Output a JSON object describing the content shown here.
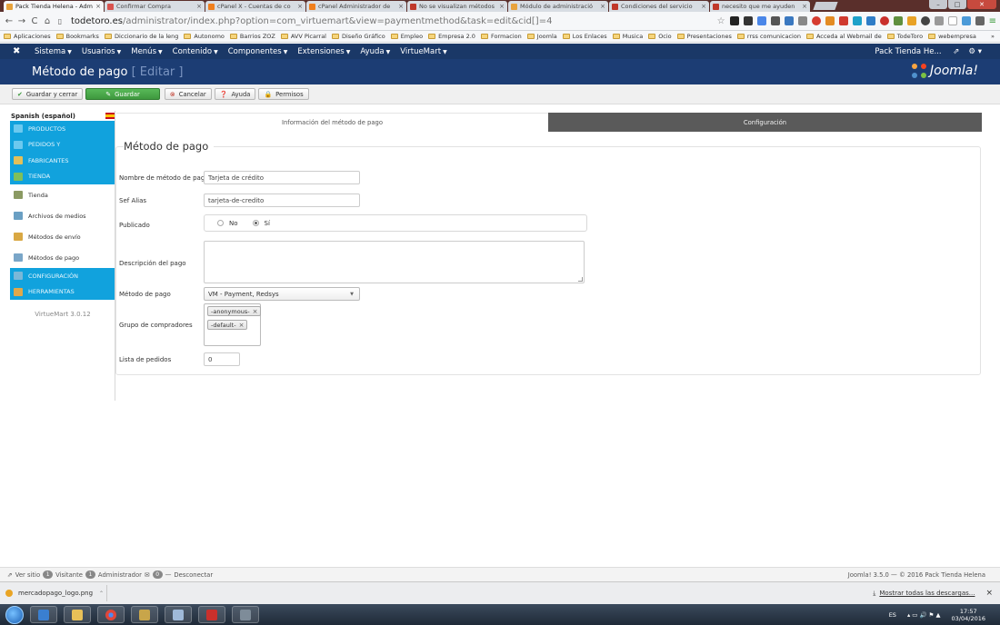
{
  "browser": {
    "tabs": [
      {
        "label": "Pack Tienda Helena - Adm",
        "color": "#e8a33c",
        "active": true
      },
      {
        "label": "Confirmar Compra",
        "color": "#d9534f",
        "active": false
      },
      {
        "label": "cPanel X - Cuentas de co",
        "color": "#f07f1d",
        "active": false
      },
      {
        "label": "cPanel Administrador de",
        "color": "#f07f1d",
        "active": false
      },
      {
        "label": "No se visualizan métodos",
        "color": "#c0392b",
        "active": false
      },
      {
        "label": "Módulo de administració",
        "color": "#e8a33c",
        "active": false
      },
      {
        "label": "Condiciones del servicio",
        "color": "#c0392b",
        "active": false
      },
      {
        "label": "necesito que me ayuden",
        "color": "#c0392b",
        "active": false
      }
    ],
    "url_host": "todetoro.es",
    "url_path": "/administrator/index.php?option=com_virtuemart&view=paymentmethod&task=edit&cid[]=4",
    "bookmarks": [
      "Aplicaciones",
      "Bookmarks",
      "Diccionario de la leng",
      "Autonomo",
      "Barrios ZOZ",
      "AVV Picarral",
      "Diseño Gráfico",
      "Empleo",
      "Empresa 2.0",
      "Formacion",
      "Joomla",
      "Los Enlaces",
      "Musica",
      "Ocio",
      "Presentaciones",
      "rrss comunicacion",
      "Acceda al Webmail de",
      "TodeToro",
      "webempresa"
    ],
    "more_bookmarks": "»"
  },
  "navbar": {
    "menus": [
      "Sistema",
      "Usuarios",
      "Menús",
      "Contenido",
      "Componentes",
      "Extensiones",
      "Ayuda",
      "VirtueMart"
    ],
    "site_name": "Pack Tienda He...",
    "brand": "Joomla!"
  },
  "header": {
    "title": "Método de pago",
    "subtitle": "[ Editar ]"
  },
  "toolbar": {
    "save_close": "Guardar y cerrar",
    "save": "Guardar",
    "cancel": "Cancelar",
    "help": "Ayuda",
    "permissions": "Permisos"
  },
  "sidebar": {
    "language": "Spanish (español)",
    "items": [
      {
        "label": "PRODUCTOS",
        "type": "blue",
        "icon": "#6cc9ef"
      },
      {
        "label": "PEDIDOS Y",
        "type": "blue",
        "icon": "#6cc9ef"
      },
      {
        "label": "FABRICANTES",
        "type": "blue",
        "icon": "#e2c05a"
      },
      {
        "label": "TIENDA",
        "type": "blue",
        "icon": "#7fbf5a"
      },
      {
        "label": "Tienda",
        "type": "white",
        "icon": "#8b9a63"
      },
      {
        "label": "Archivos de medios",
        "type": "white",
        "icon": "#6a9fc3"
      },
      {
        "label": "Métodos de envío",
        "type": "white",
        "icon": "#d9a843"
      },
      {
        "label": "Métodos de pago",
        "type": "white",
        "icon": "#7aa6c8"
      },
      {
        "label": "CONFIGURACIÓN",
        "type": "blue",
        "icon": "#7ab8d8"
      },
      {
        "label": "HERRAMIENTAS",
        "type": "blue",
        "icon": "#e0a84a"
      }
    ],
    "version": "VirtueMart 3.0.12"
  },
  "tabs": {
    "info": "Información del método de pago",
    "config": "Configuración"
  },
  "form": {
    "legend": "Método de pago",
    "name_label": "Nombre de método de pago",
    "name_value": "Tarjeta de crédito",
    "alias_label": "Sef Alias",
    "alias_value": "tarjeta-de-credito",
    "published_label": "Publicado",
    "published_no": "No",
    "published_yes": "Sí",
    "description_label": "Descripción del pago",
    "method_label": "Método de pago",
    "method_value": "VM - Payment, Redsys",
    "groups_label": "Grupo de compradores",
    "groups": [
      "-anonymous-",
      "-default-"
    ],
    "order_label": "Lista de pedidos",
    "order_value": "0"
  },
  "status": {
    "view_site": "Ver sitio",
    "visitors_count": "1",
    "visitors": "Visitante",
    "admins_count": "1",
    "admins": "Administrador",
    "messages_count": "0",
    "logout": "Desconectar",
    "copyright": "Joomla! 3.5.0 — © 2016 Pack Tienda Helena"
  },
  "downloads": {
    "file": "mercadopago_logo.png",
    "show_all": "Mostrar todas las descargas...",
    "close": "×"
  },
  "taskbar": {
    "lang": "ES",
    "time": "17:57",
    "date": "03/04/2016"
  }
}
